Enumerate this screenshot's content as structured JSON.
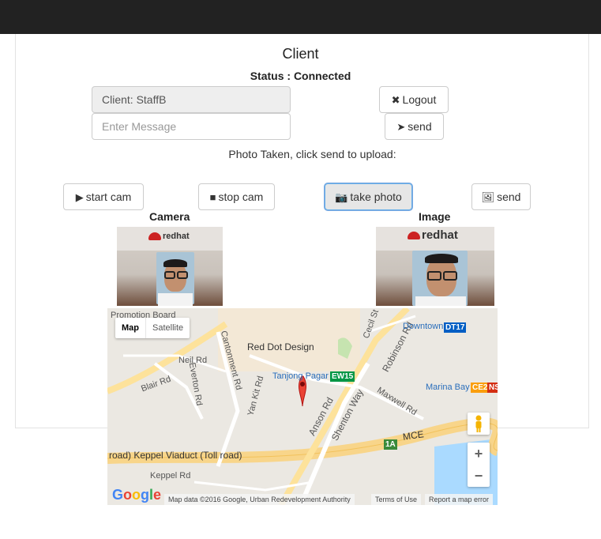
{
  "page": {
    "title": "Client",
    "status_label": "Status : ",
    "status_value": "Connected"
  },
  "client_field": {
    "value": "Client: StaffB"
  },
  "message_field": {
    "placeholder": "Enter Message"
  },
  "buttons": {
    "logout": "Logout",
    "send_message": "send",
    "start_cam": "start cam",
    "stop_cam": "stop cam",
    "take_photo": "take photo",
    "send_image": "send"
  },
  "icons": {
    "logout": "close-icon",
    "send_message": "paper-plane-icon",
    "start_cam": "play-icon",
    "stop_cam": "stop-icon",
    "take_photo": "camera-icon",
    "send_image": "picture-icon"
  },
  "hint": "Photo Taken, click send to upload:",
  "camera_label": "Camera",
  "image_label": "Image",
  "photo": {
    "logo_text": "redhat"
  },
  "map": {
    "map_type": {
      "map": "Map",
      "satellite": "Satellite"
    },
    "labels": {
      "promotion_board": "Promotion Board",
      "red_dot": "Red Dot Design",
      "neil_rd": "Neil Rd",
      "blair_rd": "Blair Rd",
      "everton_rd": "Everton Rd",
      "cantonment_rd": "Cantonment Rd",
      "yan_kit_rd": "Yan Kit Rd",
      "cecil_st": "Cecil St",
      "robinson_rd": "Robinson Rd",
      "downtown": "Downtown",
      "tanjong_pagar": "Tanjong Pagar",
      "anson_rd": "Anson Rd",
      "shenton_way": "Shenton Way",
      "maxwell_rd": "Maxwell Rd",
      "marina_bay": "Marina Bay",
      "mce": "MCE",
      "keppel_viaduct": "road)  Keppel Viaduct (Toll road)",
      "keppel_rd": "Keppel Rd"
    },
    "badges": {
      "dt17": "DT17",
      "ew15": "EW15",
      "ce2": "CE2",
      "ns": "NS",
      "r1a": "1A"
    },
    "zoom_in": "+",
    "zoom_out": "−",
    "google": "Google",
    "map_data": "Map data ©2016 Google, Urban Redevelopment Authority",
    "terms": "Terms of Use",
    "report": "Report a map error"
  },
  "colors": {
    "topbar": "#222222",
    "active_border": "#66afe9",
    "marker": "#ea4335"
  }
}
